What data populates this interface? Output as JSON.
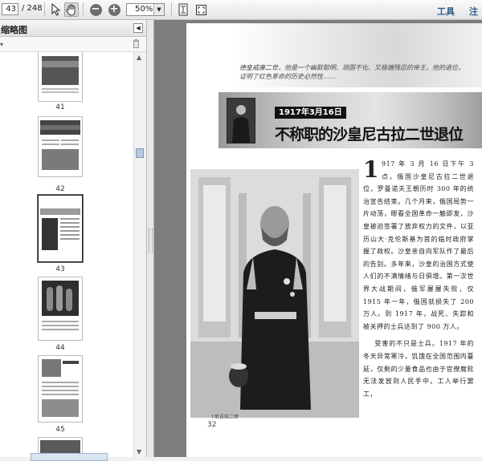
{
  "toolbar": {
    "current_page": "43",
    "total_pages": "/ 248",
    "zoom": "50%",
    "menu_tools": "工具",
    "menu_comment": "注释"
  },
  "sidebar": {
    "title": "缩略图",
    "thumbnails": [
      {
        "label": "41"
      },
      {
        "label": "42"
      },
      {
        "label": "43",
        "selected": true
      },
      {
        "label": "44"
      },
      {
        "label": "45"
      }
    ]
  },
  "document": {
    "intro": "德皇威廉二世，他是一个幽默聪明、顽固不化、又极端残忍的帝王，他的退位，证明了红色革命的历史必然性……",
    "date_tag": "1917年3月16日",
    "title": "不称职的沙皇尼古拉二世退位",
    "caption": "↑尼古拉二世",
    "dropcap": "1",
    "para1": "917 年 3 月 16 日下午 3 点，俄国沙皇尼古拉二世退位，罗曼诺夫王朝历时 300 年的统治宣告结束。几个月来，俄国局势一片动荡，眼看全国革命一触即发，沙皇被迫签署了放弃权力的文件，以亚历山大·克伦斯基为首的临时政府掌握了政权。沙皇亲自向军队作了最后的告别。多年来，沙皇的治国方式使人们的不满情绪与日俱增。第一次世界大战期间，俄军屡屡失败，仅 1915 年一年，俄国就损失了 200 万人。到 1917 年，战死、失踪和被关押的士兵达到了 900 万人。",
    "para2": "受害的不只是士兵。1917 年的冬天异常寒冷，饥饿在全国范围内蔓延，仅剩的少量食品也由于官僚腐败无法发放到人民手中。工人举行罢工，",
    "page_number": "32"
  }
}
